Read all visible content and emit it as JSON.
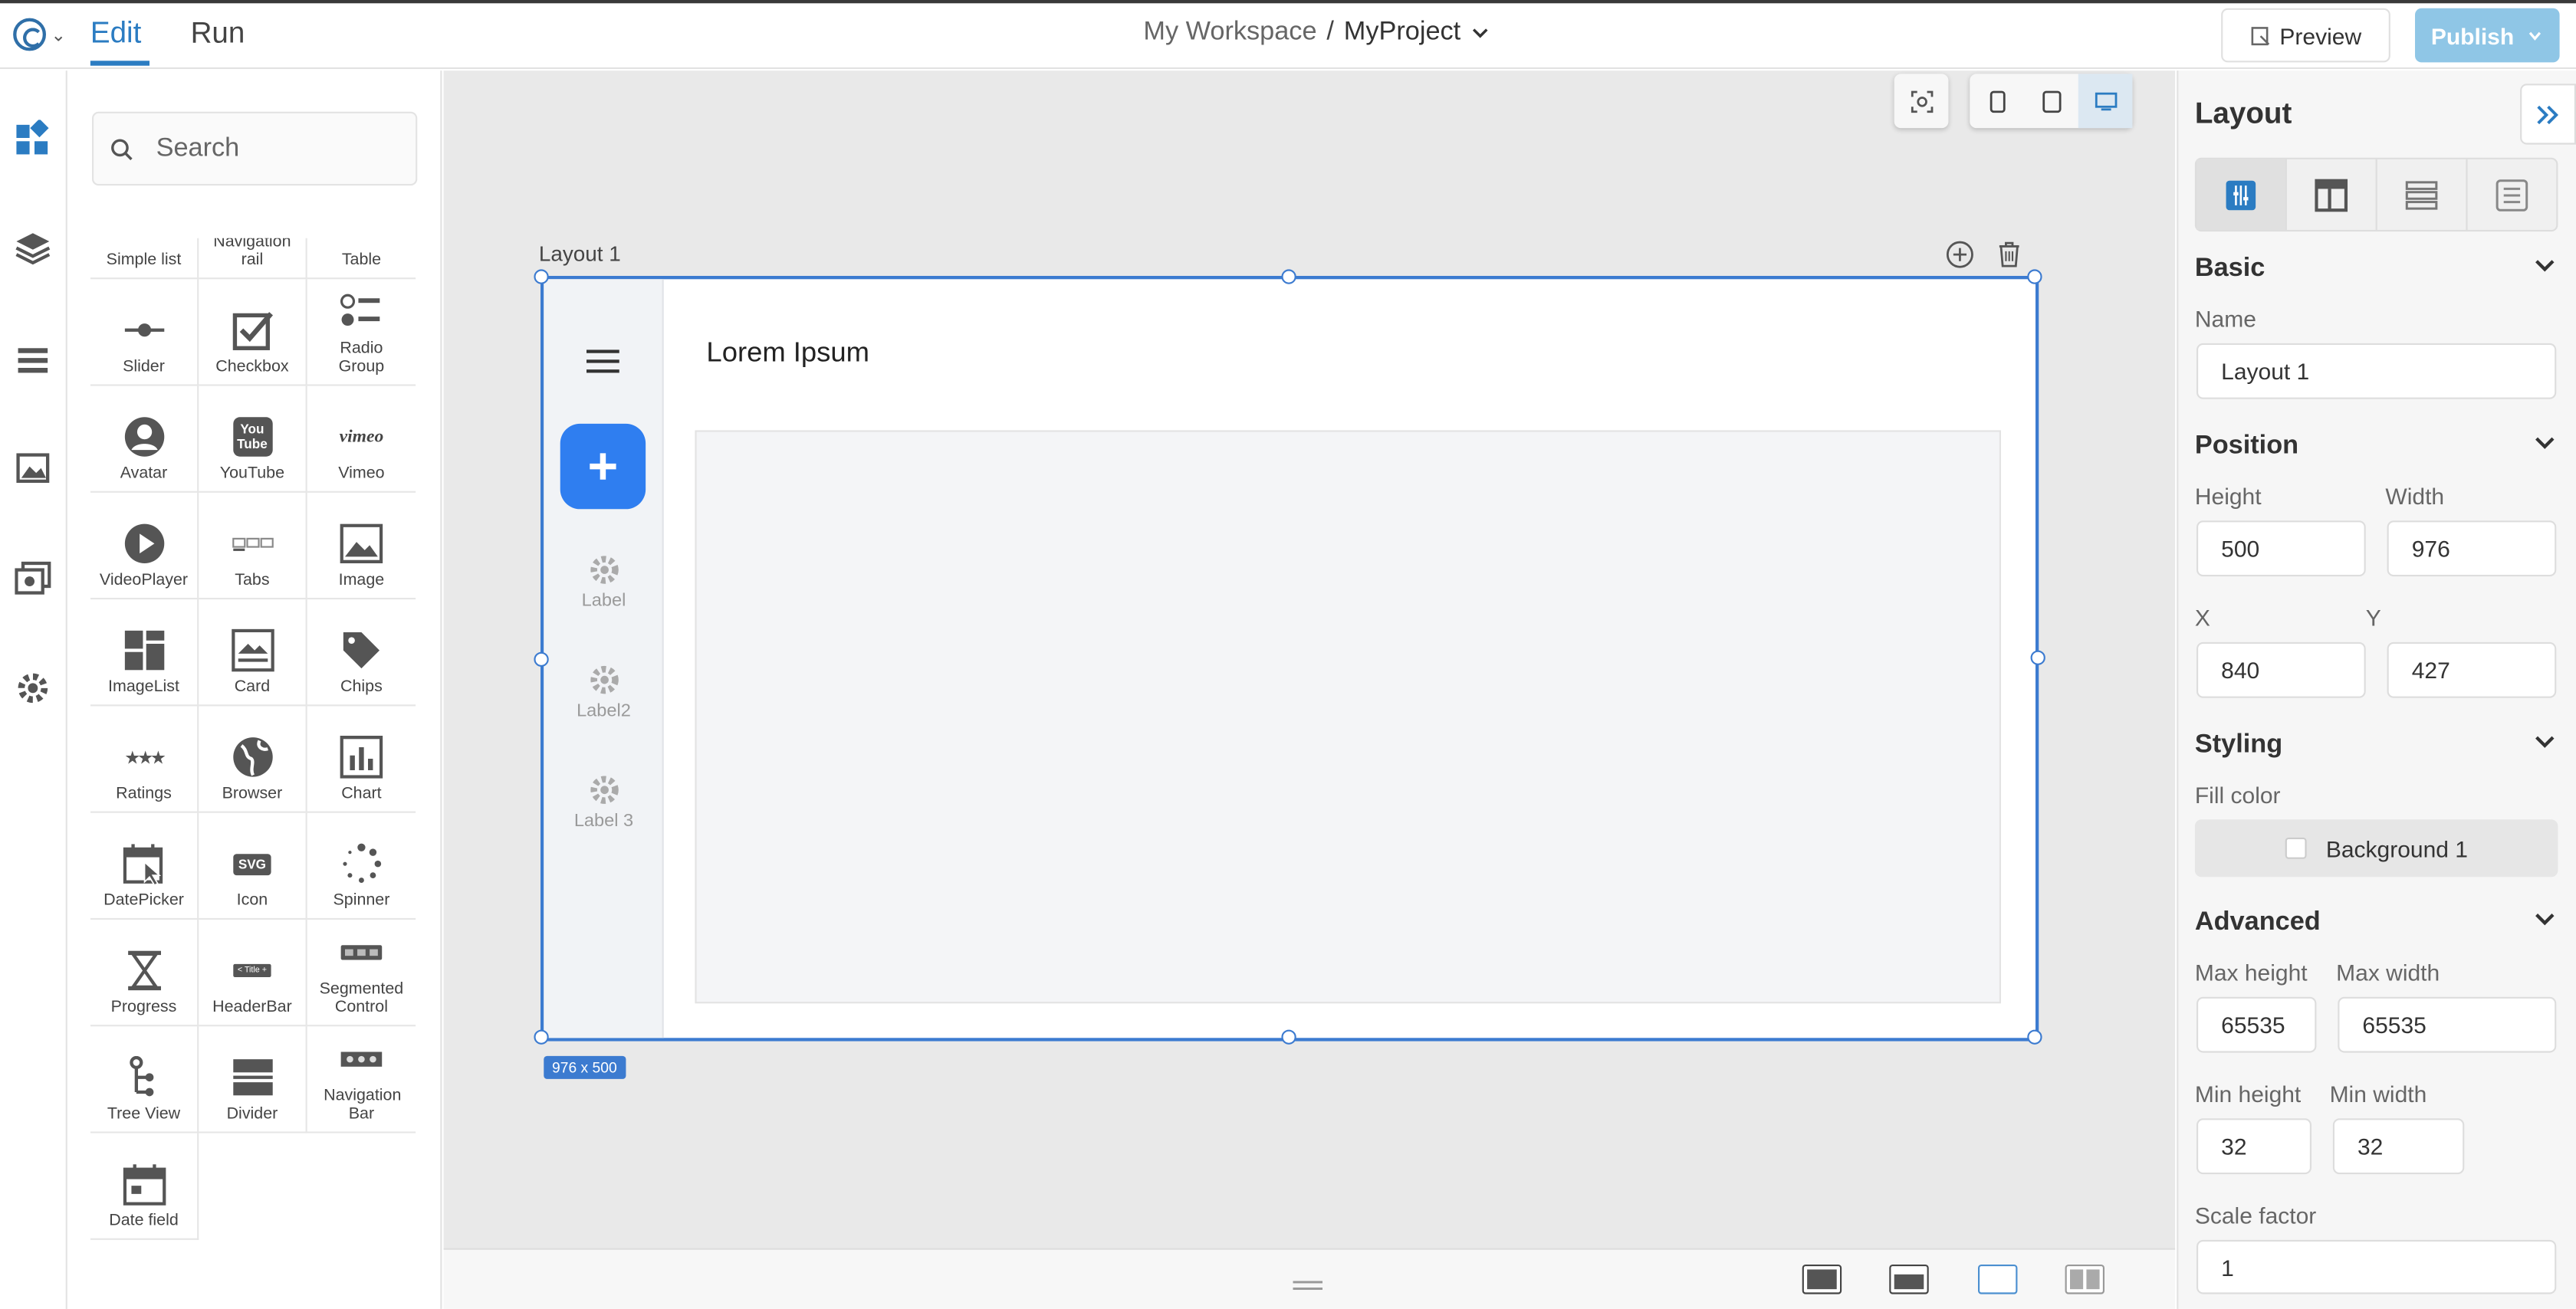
{
  "header": {
    "tabs": [
      {
        "label": "Edit"
      },
      {
        "label": "Run"
      }
    ],
    "workspace": "My Workspace",
    "separator": "/",
    "project": "MyProject",
    "preview_label": "Preview",
    "publish_label": "Publish"
  },
  "left_rail": {
    "icons": [
      "widgets-icon",
      "layers-icon",
      "list-icon",
      "media-icon",
      "assets-icon",
      "settings-icon"
    ]
  },
  "components": {
    "search_placeholder": "Search",
    "items": [
      {
        "label": "Simple list"
      },
      {
        "label": "Navigation rail"
      },
      {
        "label": "Table"
      },
      {
        "label": "Slider"
      },
      {
        "label": "Checkbox"
      },
      {
        "label": "Radio Group"
      },
      {
        "label": "Avatar"
      },
      {
        "label": "YouTube"
      },
      {
        "label": "Vimeo"
      },
      {
        "label": "VideoPlayer"
      },
      {
        "label": "Tabs"
      },
      {
        "label": "Image"
      },
      {
        "label": "ImageList"
      },
      {
        "label": "Card"
      },
      {
        "label": "Chips"
      },
      {
        "label": "Ratings"
      },
      {
        "label": "Browser"
      },
      {
        "label": "Chart"
      },
      {
        "label": "DatePicker"
      },
      {
        "label": "Icon"
      },
      {
        "label": "Spinner"
      },
      {
        "label": "Progress"
      },
      {
        "label": "HeaderBar"
      },
      {
        "label": "Segmented Control"
      },
      {
        "label": "Tree View"
      },
      {
        "label": "Divider"
      },
      {
        "label": "Navigation Bar"
      },
      {
        "label": "Date field"
      }
    ],
    "youtube_you": "You",
    "youtube_tube": "Tube",
    "vimeo_text": "vimeo",
    "svg_text": "SVG",
    "headerbar_text": "< Title +"
  },
  "canvas": {
    "layout_label": "Layout 1",
    "title": "Lorem Ipsum",
    "nav_items": [
      {
        "label": "Label"
      },
      {
        "label": "Label2"
      },
      {
        "label": "Label 3"
      }
    ],
    "size_badge": "976 x 500",
    "accent": "#3c7bd0",
    "fab_color": "#2f7ef0"
  },
  "props": {
    "title": "Layout",
    "basic": {
      "title": "Basic",
      "name_label": "Name",
      "name_value": "Layout 1"
    },
    "position": {
      "title": "Position",
      "height_label": "Height",
      "height_value": "500",
      "width_label": "Width",
      "width_value": "976",
      "x_label": "X",
      "x_value": "840",
      "y_label": "Y",
      "y_value": "427"
    },
    "styling": {
      "title": "Styling",
      "fill_label": "Fill color",
      "fill_value": "Background 1"
    },
    "advanced": {
      "title": "Advanced",
      "max_height_label": "Max height",
      "max_height_value": "65535",
      "max_width_label": "Max width",
      "max_width_value": "65535",
      "min_height_label": "Min height",
      "min_height_value": "32",
      "min_width_label": "Min width",
      "min_width_value": "32",
      "scale_label": "Scale factor",
      "scale_value": "1"
    }
  }
}
